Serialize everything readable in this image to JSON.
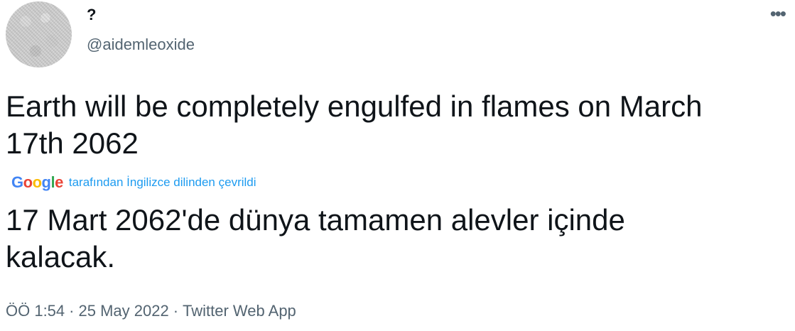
{
  "author": {
    "display_name": "?",
    "handle": "@aidemleoxide"
  },
  "menu": {
    "more_icon": "•••"
  },
  "tweet": {
    "text_line1": "Earth will be completely engulfed in flames on March",
    "text_line2": "17th 2062",
    "translation": {
      "provider_letters": [
        "G",
        "o",
        "o",
        "g",
        "l",
        "e"
      ],
      "label": "tarafından İngilizce dilinden çevrildi",
      "text_line1": "17 Mart 2062'de dünya tamamen alevler içinde",
      "text_line2": "kalacak."
    },
    "meta": {
      "time": "ÖÖ 1:54",
      "separator1": "·",
      "date": "25 May 2022",
      "separator2": "·",
      "client": "Twitter Web App"
    }
  },
  "colors": {
    "accent": "#1d9bf0",
    "text_primary": "#0f1419",
    "text_secondary": "#536471"
  }
}
